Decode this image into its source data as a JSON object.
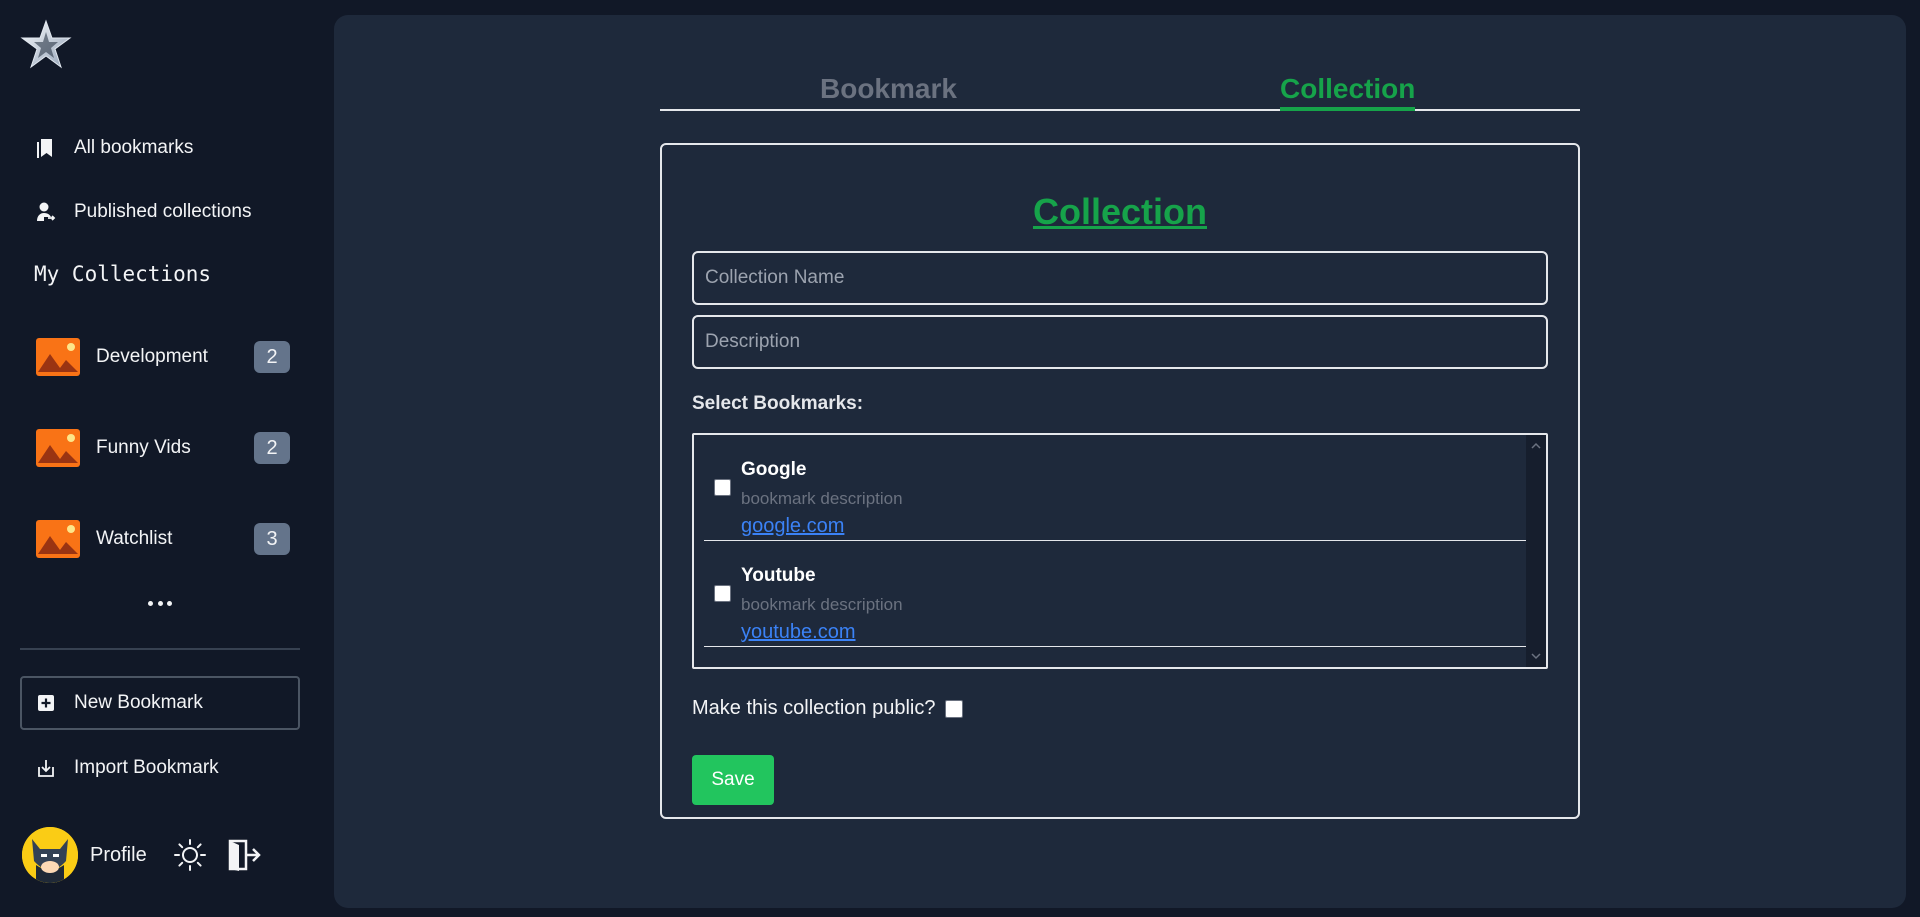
{
  "sidebar": {
    "nav": [
      {
        "label": "All bookmarks",
        "icon": "bookmarks-icon"
      },
      {
        "label": "Published collections",
        "icon": "user-share-icon"
      }
    ],
    "section_title": "My Collections",
    "collections": [
      {
        "name": "Development",
        "count": "2"
      },
      {
        "name": "Funny Vids",
        "count": "2"
      },
      {
        "name": "Watchlist",
        "count": "3"
      }
    ],
    "more": "more-dots-icon",
    "actions": [
      {
        "label": "New Bookmark",
        "icon": "plus-square-icon"
      },
      {
        "label": "Import Bookmark",
        "icon": "import-icon"
      }
    ],
    "profile_label": "Profile"
  },
  "tabs": [
    {
      "label": "Bookmark",
      "active": false
    },
    {
      "label": "Collection",
      "active": true
    }
  ],
  "form": {
    "title": "Collection",
    "name_placeholder": "Collection Name",
    "description_placeholder": "Description",
    "select_label": "Select Bookmarks:",
    "bookmarks": [
      {
        "title": "Google",
        "description": "bookmark description",
        "url": "google.com",
        "checked": false
      },
      {
        "title": "Youtube",
        "description": "bookmark description",
        "url": "youtube.com",
        "checked": false
      }
    ],
    "public_label": "Make this collection public?",
    "public_checked": false,
    "save_label": "Save"
  },
  "colors": {
    "accent": "#16a34a",
    "save": "#22c55e",
    "link": "#3b82f6",
    "background": "#111827",
    "panel": "#1e293b",
    "badge": "#64748b",
    "thumb": "#f97316"
  }
}
